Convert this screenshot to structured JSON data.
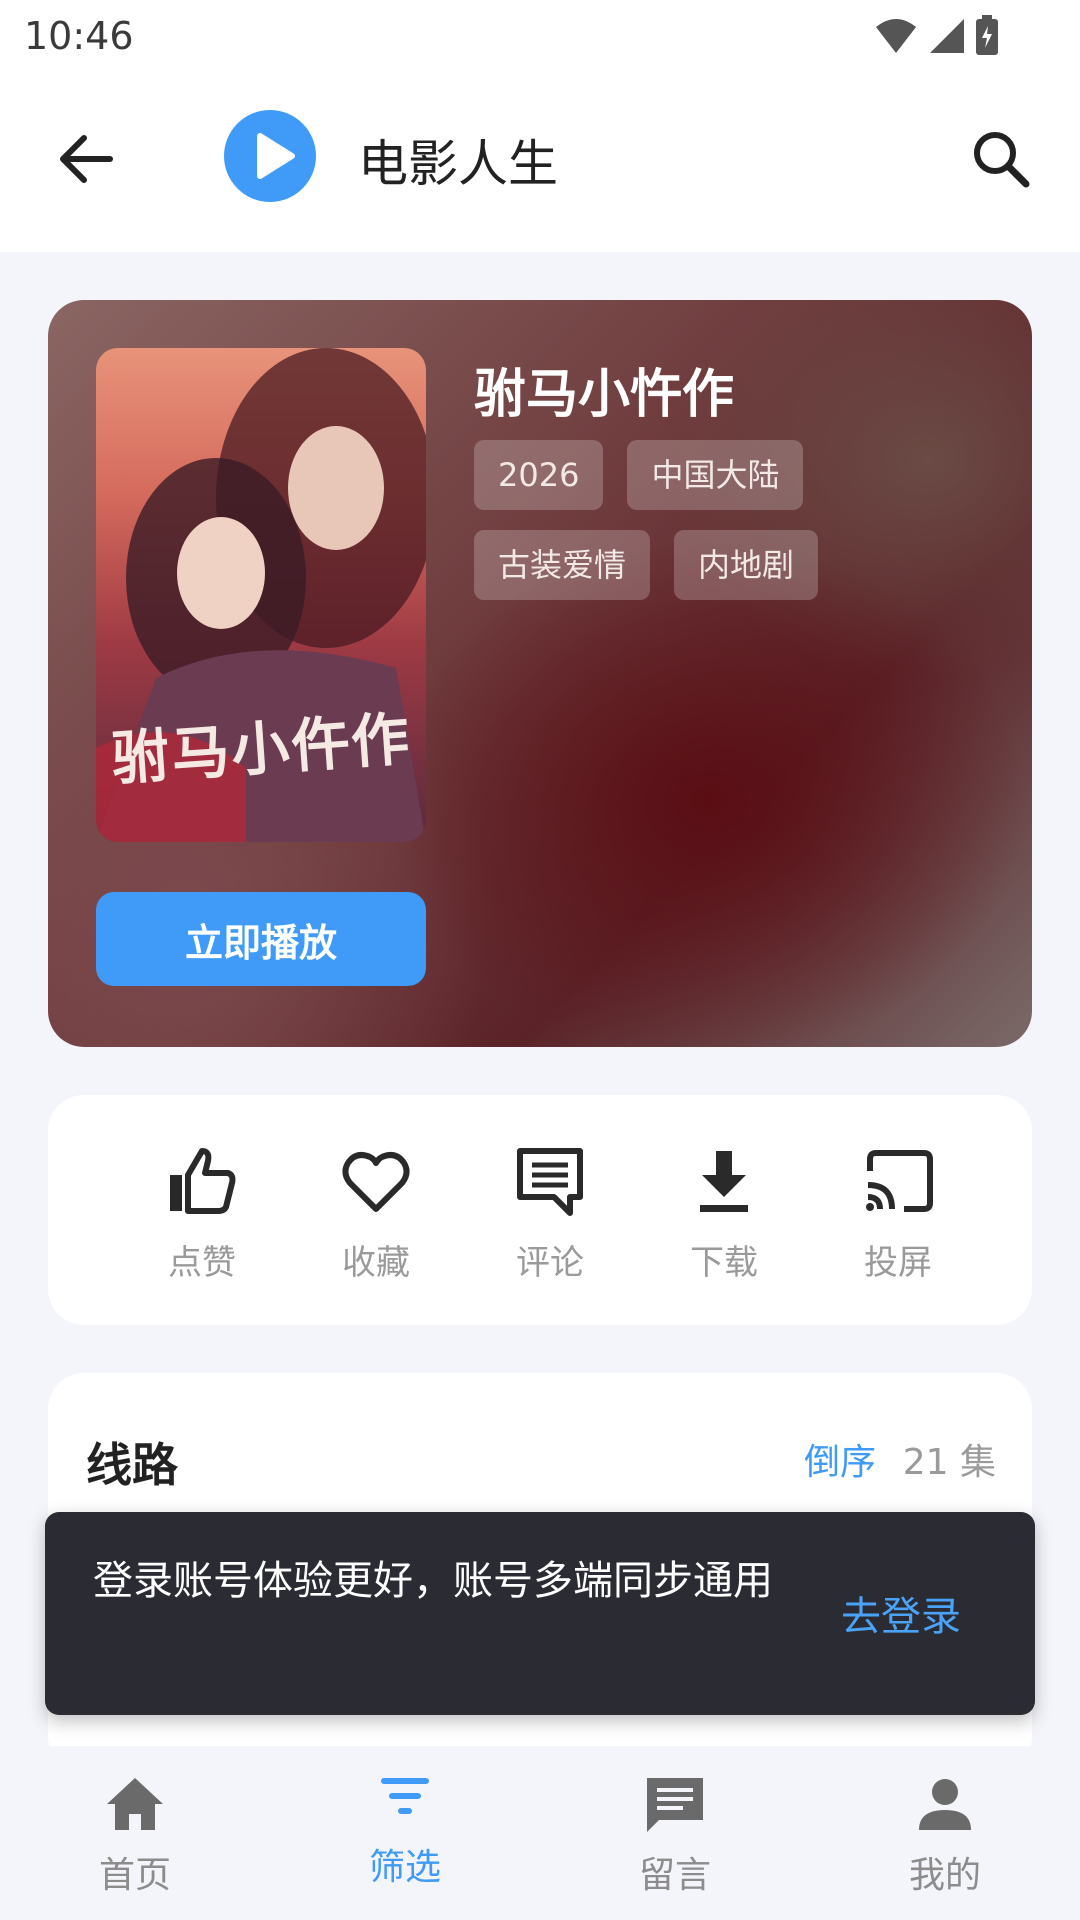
{
  "status_bar": {
    "time": "10:46"
  },
  "app_bar": {
    "title": "电影人生"
  },
  "hero": {
    "title": "驸马小忤作",
    "poster_title": "驸马小仵作",
    "tags_row1": [
      "2026",
      "中国大陆"
    ],
    "tags_row2": [
      "古装爱情",
      "内地剧"
    ],
    "play_label": "立即播放"
  },
  "actions": [
    {
      "label": "点赞",
      "icon": "thumb-up-icon"
    },
    {
      "label": "收藏",
      "icon": "heart-icon"
    },
    {
      "label": "评论",
      "icon": "comment-icon"
    },
    {
      "label": "下载",
      "icon": "download-icon"
    },
    {
      "label": "投屏",
      "icon": "cast-icon"
    }
  ],
  "route": {
    "title": "线路",
    "sort_label": "倒序",
    "count": "21 集"
  },
  "snackbar": {
    "message": "登录账号体验更好，账号多端同步通用",
    "action": "去登录"
  },
  "bottom_nav": [
    {
      "label": "首页",
      "icon": "home-icon",
      "active": false
    },
    {
      "label": "筛选",
      "icon": "filter-icon",
      "active": true
    },
    {
      "label": "留言",
      "icon": "message-icon",
      "active": false
    },
    {
      "label": "我的",
      "icon": "person-icon",
      "active": false
    }
  ],
  "colors": {
    "accent": "#3f9bf7",
    "snackbar_bg": "#2b2c33",
    "page_bg": "#f4f5fa"
  }
}
